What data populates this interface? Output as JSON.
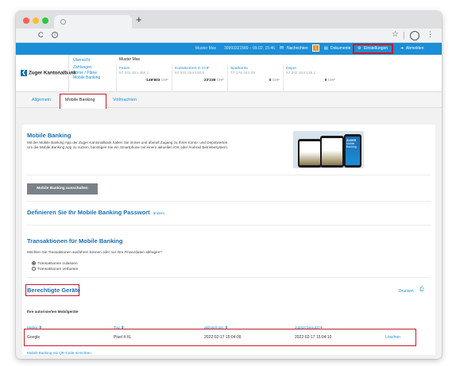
{
  "browser": {
    "new_tab_symbol": "+",
    "reload_symbol": "C",
    "info_symbol": "i",
    "star_symbol": "☆",
    "menu_symbol": "⋮"
  },
  "topbar": {
    "user": "Muster Max",
    "session": "30993321589 – 09.02. 15:46",
    "messages_label": "Nachrichten",
    "messages_count": "1",
    "documents_label": "Dokumente",
    "settings_label": "Einstellungen",
    "logout_label": "Abmelden",
    "accent_color": "#1a8ed6",
    "highlight_color": "#c61c2c"
  },
  "overview": {
    "bank_name": "Zuger Kantonalbank",
    "links": [
      "Übersicht",
      "Zahlungen",
      "Börse / Pläne",
      "Mobile Banking"
    ],
    "owner": "Muster Max",
    "accounts": [
      {
        "type": "Ferien",
        "number": "57.202.324.366.1",
        "amount": "-149'803",
        "currency": "CHF"
      },
      {
        "type": "Kontokorrent in CHF",
        "number": "57.202.324.160.5",
        "amount": "23'239",
        "currency": "CHF"
      },
      {
        "type": "Sparkonto",
        "number": "77-176.341-0X",
        "amount": "0",
        "currency": "CHF"
      },
      {
        "type": "Depot",
        "number": "57.202.324.135.1",
        "amount": "0",
        "currency": "CHF"
      }
    ]
  },
  "tabs": {
    "general": "Allgemein",
    "mobile_banking": "Mobile Banking",
    "powers": "Vollmachten"
  },
  "mobile_banking": {
    "title": "Mobile Banking",
    "description": "Mit der Mobile Banking App der Zuger Kantonalbank haben Sie immer und überall Zugang zu Ihren Konto- und Depotwerten. Um die Mobile Banking App zu nutzen, benötigen Sie ein Smartphone mit einem aktuellen iOS oder Android Betriebssystem.",
    "promo_brand": "ZUGER",
    "promo_caption": "Mobile Banking",
    "deactivate_button": "Mobile Banking ausschalten",
    "password_title": "Definieren Sie Ihr Mobile Banking Passwort",
    "password_link": "ändern",
    "transactions_title": "Transaktionen für Mobile Banking",
    "transactions_question": "Möchten Sie Transaktionen ausführen können oder nur Ihre Finanzdaten abfragen?",
    "options": [
      "Transaktionen zulassen",
      "Transaktionen verbieten"
    ],
    "devices_title": "Berechtigte Geräte",
    "print_label": "Drucken",
    "devices_subtitle": "Ihre autorisierten Mobilgeräte",
    "columns": [
      "Marke ⬍",
      "Typ ⬍",
      "aktiviert am ⬍",
      "zuletzt benutzt ▾"
    ],
    "devices": [
      {
        "brand": "Google",
        "type": "Pixel 4 XL",
        "activated": "2022-02-17 15:04:09",
        "last_used": "2022-02-17 15:04:10",
        "action": "Löschen"
      }
    ],
    "qr_link": "Mobile Banking mit QR-Code einrichten"
  }
}
